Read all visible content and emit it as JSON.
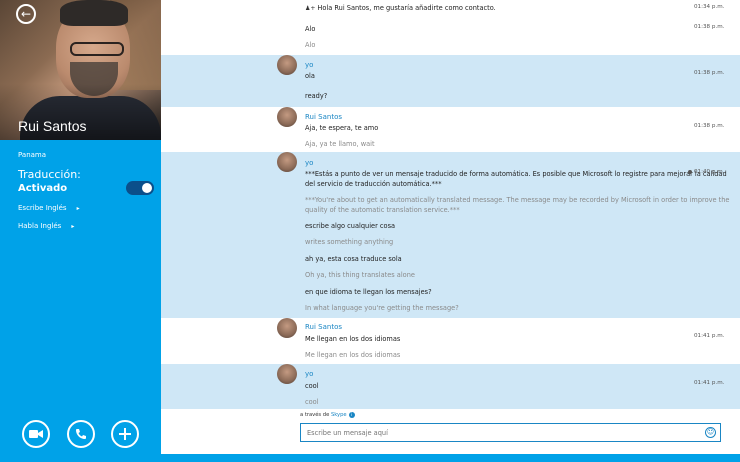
{
  "contact": {
    "name": "Rui Santos",
    "location": "Panama"
  },
  "translation": {
    "label": "Traducción:",
    "status": "Activado",
    "enabled": true,
    "write_lang": "Escribe Inglés",
    "speak_lang": "Habla Inglés"
  },
  "icons": {
    "back": "back-arrow-icon",
    "video": "video-camera-icon",
    "call": "phone-icon",
    "add": "plus-icon",
    "emoji": "emoji-icon",
    "contact_request": "add-contact-icon"
  },
  "colors": {
    "accent": "#00a2e8",
    "self_bubble": "#cfe7f6",
    "link": "#1a86c4"
  },
  "messages": {
    "m0": {
      "l1": "Hola Rui  Santos, me gustaría añadirte como contacto.",
      "t1": "01:34 p.m.",
      "l2": "Alo",
      "t2": "01:38 p.m.",
      "l3": "Alo"
    },
    "m1": {
      "sender": "yo",
      "l1": "ola",
      "t1": "01:38 p.m.",
      "l2": "ready?"
    },
    "m2": {
      "sender": "Rui Santos",
      "l1": "Aja, te espera, te amo",
      "t1": "01:38 p.m.",
      "l2": "Aja, ya te llamo, wait"
    },
    "m3": {
      "sender": "yo",
      "l1": "***Estás a punto de ver un mensaje traducido de forma automática. Es posible que Microsoft lo registre para mejorar la calidad",
      "l1b": "del servicio de traducción automática.***",
      "t1": "01:40 p.m.",
      "l2": "***You're about to get an automatically translated message. The message may be recorded by Microsoft in order to improve the",
      "l2b": "quality of the automatic translation service.***",
      "l3": "escribe algo cualquier cosa",
      "l4": "writes something anything",
      "l5": "ah ya, esta cosa traduce sola",
      "l6": "Oh ya, this thing translates alone",
      "l7": "en que idioma te llegan los mensajes?",
      "l8": "In what language you're getting the message?"
    },
    "m4": {
      "sender": "Rui Santos",
      "l1": "Me llegan en los dos idiomas",
      "t1": "01:41 p.m.",
      "l2": "Me llegan en los dos idiomas"
    },
    "m5": {
      "sender": "yo",
      "l1": "cool",
      "t1": "01:41 p.m.",
      "l2": "cool"
    }
  },
  "compose": {
    "via_prefix": "a través de",
    "via_service": "Skype",
    "placeholder": "Escribe un mensaje aquí"
  }
}
